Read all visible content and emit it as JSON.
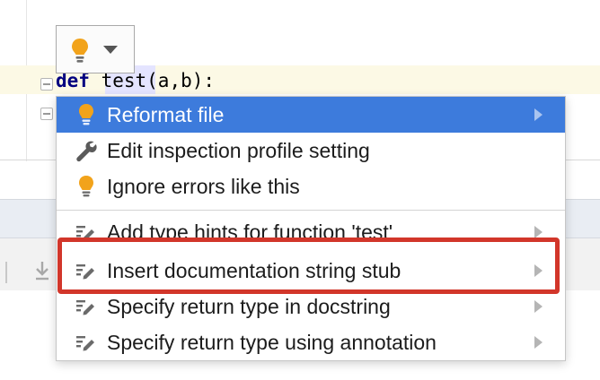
{
  "editor": {
    "code_keyword": "def",
    "code_rest": " test(a,b):"
  },
  "intention_button": {
    "icon": "lightbulb-icon",
    "caret_icon": "caret-down-icon"
  },
  "menu": {
    "items": [
      {
        "label": "Reformat file",
        "icon": "lightbulb-icon",
        "selected": true,
        "has_submenu": true
      },
      {
        "label": "Edit inspection profile setting",
        "icon": "wrench-icon",
        "selected": false,
        "has_submenu": false
      },
      {
        "label": "Ignore errors like this",
        "icon": "lightbulb-icon",
        "selected": false,
        "has_submenu": false
      },
      {
        "label": "Add type hints for function 'test'",
        "icon": "pencil-edit-icon",
        "selected": false,
        "has_submenu": true
      },
      {
        "label": "Insert documentation string stub",
        "icon": "pencil-edit-icon",
        "selected": false,
        "has_submenu": true,
        "highlighted": true
      },
      {
        "label": "Specify return type in docstring",
        "icon": "pencil-edit-icon",
        "selected": false,
        "has_submenu": true
      },
      {
        "label": "Specify return type using annotation",
        "icon": "pencil-edit-icon",
        "selected": false,
        "has_submenu": true
      }
    ]
  },
  "colors": {
    "selection": "#3d7bdc",
    "annotation": "#d2362a",
    "bulb": "#f2a31b",
    "keyword": "#000080"
  }
}
